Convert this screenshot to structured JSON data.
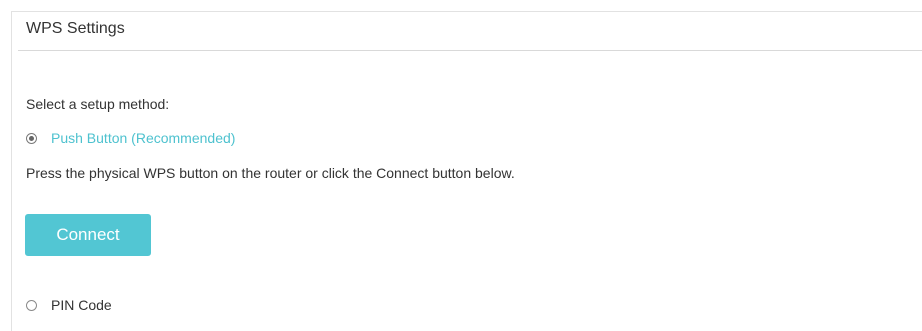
{
  "panel": {
    "title": "WPS Settings"
  },
  "setup": {
    "label": "Select a setup method:",
    "options": [
      {
        "label": "Push Button (Recommended)",
        "selected": true
      },
      {
        "label": "PIN Code",
        "selected": false
      }
    ],
    "push_hint": "Press the physical WPS button on the router or click the Connect button below.",
    "connect_label": "Connect"
  },
  "colors": {
    "accent": "#52c6d3",
    "selected_label": "#4ec2cf",
    "text": "#333333"
  }
}
